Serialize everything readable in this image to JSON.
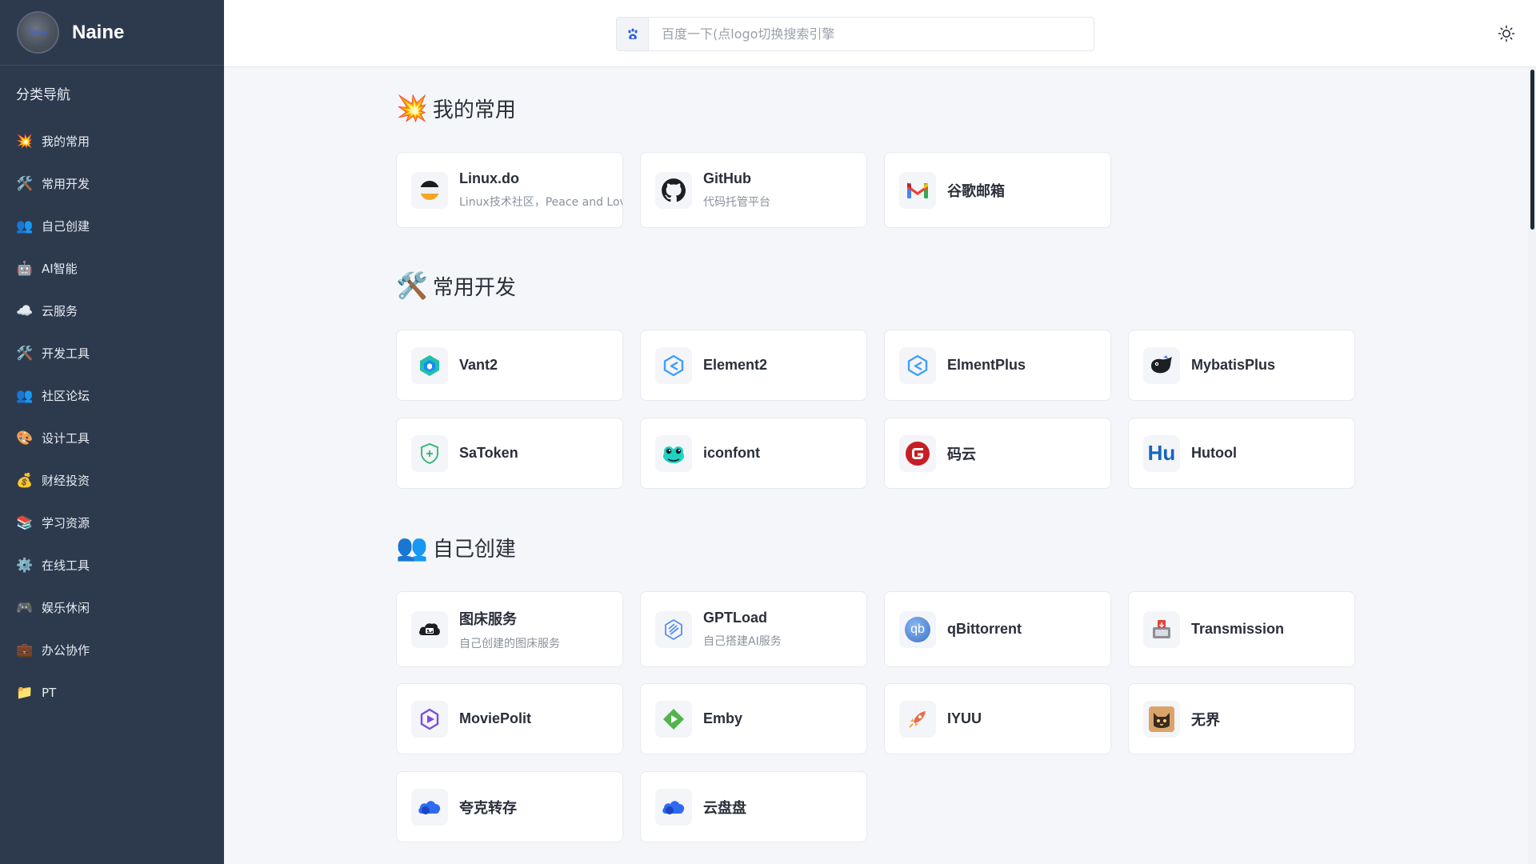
{
  "sidebar": {
    "brand": {
      "name": "Naine",
      "avatar_text": "Naine"
    },
    "nav_title": "分类导航",
    "items": [
      {
        "icon": "💥",
        "label": "我的常用"
      },
      {
        "icon": "🛠️",
        "label": "常用开发"
      },
      {
        "icon": "👥",
        "label": "自己创建"
      },
      {
        "icon": "🤖",
        "label": "AI智能"
      },
      {
        "icon": "☁️",
        "label": "云服务"
      },
      {
        "icon": "🛠️",
        "label": "开发工具"
      },
      {
        "icon": "👥",
        "label": "社区论坛"
      },
      {
        "icon": "🎨",
        "label": "设计工具"
      },
      {
        "icon": "💰",
        "label": "财经投资"
      },
      {
        "icon": "📚",
        "label": "学习资源"
      },
      {
        "icon": "⚙️",
        "label": "在线工具"
      },
      {
        "icon": "🎮",
        "label": "娱乐休闲"
      },
      {
        "icon": "💼",
        "label": "办公协作"
      },
      {
        "icon": "📁",
        "label": "PT"
      }
    ]
  },
  "header": {
    "search_placeholder": "百度一下(点logo切换搜索引擎",
    "search_engine_icon": "baidu-paw-icon",
    "theme_icon": "sun-icon"
  },
  "sections": [
    {
      "icon": "💥",
      "title": "我的常用",
      "cards": [
        {
          "name": "Linux.do",
          "desc": "Linux技术社区，Peace and Love",
          "icon": "linuxdo-icon"
        },
        {
          "name": "GitHub",
          "desc": "代码托管平台",
          "icon": "github-icon"
        },
        {
          "name": "谷歌邮箱",
          "desc": "",
          "icon": "gmail-icon"
        }
      ]
    },
    {
      "icon": "🛠️",
      "title": "常用开发",
      "cards": [
        {
          "name": "Vant2",
          "desc": "",
          "icon": "vant-icon"
        },
        {
          "name": "Element2",
          "desc": "",
          "icon": "element-icon"
        },
        {
          "name": "ElmentPlus",
          "desc": "",
          "icon": "element-plus-icon"
        },
        {
          "name": "MybatisPlus",
          "desc": "",
          "icon": "mybatis-plus-icon"
        },
        {
          "name": "SaToken",
          "desc": "",
          "icon": "satoken-shield-icon"
        },
        {
          "name": "iconfont",
          "desc": "",
          "icon": "iconfont-chameleon-icon"
        },
        {
          "name": "码云",
          "desc": "",
          "icon": "gitee-icon"
        },
        {
          "name": "Hutool",
          "desc": "",
          "icon": "hutool-icon",
          "logo_text": "Hu"
        }
      ]
    },
    {
      "icon": "👥",
      "title": "自己创建",
      "cards": [
        {
          "name": "图床服务",
          "desc": "自己创建的图床服务",
          "icon": "image-host-icon"
        },
        {
          "name": "GPTLoad",
          "desc": "自己搭建AI服务",
          "icon": "gptload-icon"
        },
        {
          "name": "qBittorrent",
          "desc": "",
          "icon": "qbittorrent-icon",
          "logo_text": "qb"
        },
        {
          "name": "Transmission",
          "desc": "",
          "icon": "transmission-icon"
        },
        {
          "name": "MoviePolit",
          "desc": "",
          "icon": "moviepilot-icon"
        },
        {
          "name": "Emby",
          "desc": "",
          "icon": "emby-icon"
        },
        {
          "name": "IYUU",
          "desc": "",
          "icon": "iyuu-rocket-icon"
        },
        {
          "name": "无界",
          "desc": "",
          "icon": "wujie-cat-icon"
        },
        {
          "name": "夸克转存",
          "desc": "",
          "icon": "quark-cloud-icon"
        },
        {
          "name": "云盘盘",
          "desc": "",
          "icon": "cloud-drive-icon"
        }
      ]
    }
  ]
}
